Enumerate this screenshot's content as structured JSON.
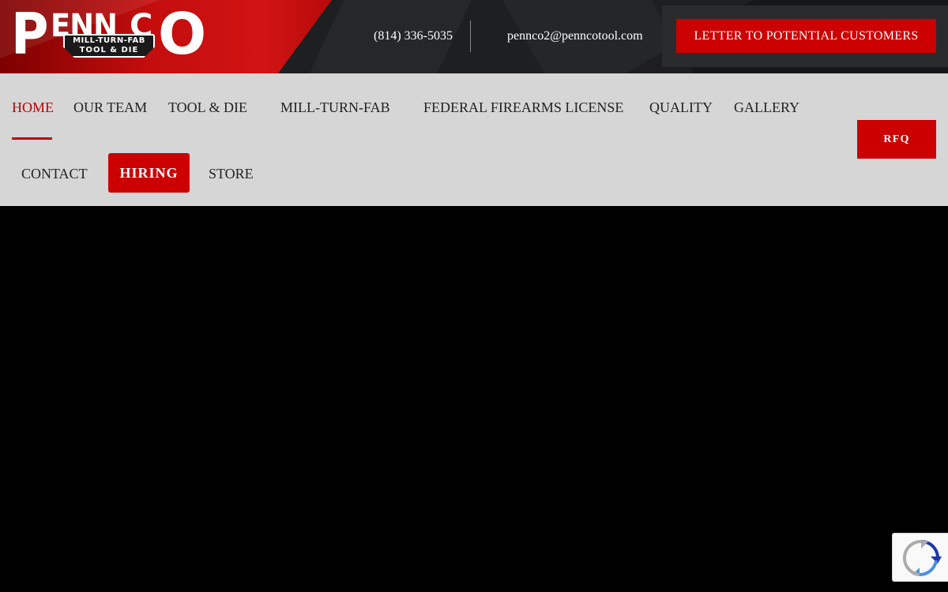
{
  "brand": {
    "logo_big_p": "P",
    "logo_enn": "ENN",
    "logo_c": "C",
    "logo_big_o": "O",
    "logo_line1": "MILL-TURN-FAB",
    "logo_line2": "TOOL & DIE",
    "accent_color": "#cc0000"
  },
  "topbar": {
    "phone": "(814) 336-5035",
    "email": "pennco2@penncotool.com",
    "letter_button": "LETTER TO POTENTIAL CUSTOMERS"
  },
  "nav": {
    "items": [
      {
        "label": "HOME",
        "active": true
      },
      {
        "label": "OUR TEAM"
      },
      {
        "label": "TOOL & DIE"
      },
      {
        "label": "MILL-TURN-FAB"
      },
      {
        "label": "FEDERAL FIREARMS LICENSE"
      },
      {
        "label": "QUALITY"
      },
      {
        "label": "GALLERY"
      },
      {
        "label": "CONTACT"
      },
      {
        "label": "HIRING"
      },
      {
        "label": "STORE"
      }
    ],
    "rfq_label": "RFQ"
  },
  "icons": {
    "recaptcha": "recaptcha-icon"
  }
}
